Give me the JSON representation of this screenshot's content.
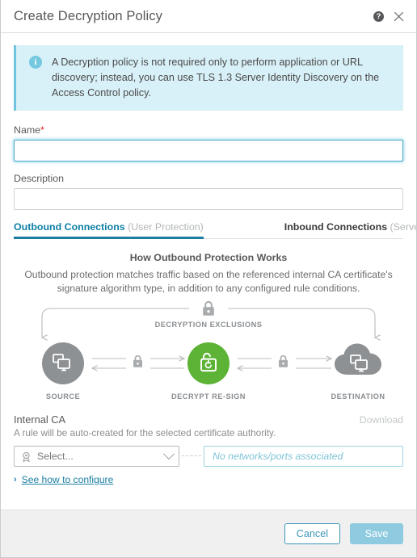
{
  "header": {
    "title": "Create Decryption Policy",
    "help_icon": "help-icon",
    "close_icon": "close-icon"
  },
  "banner": {
    "icon": "info-icon",
    "text": "A Decryption policy is not required only to perform application or URL discovery; instead, you can use TLS 1.3 Server Identity Discovery on the Access Control policy."
  },
  "form": {
    "name_label": "Name",
    "name_required_mark": "*",
    "name_value": "",
    "name_placeholder": "",
    "description_label": "Description",
    "description_value": "",
    "description_placeholder": ""
  },
  "tabs": [
    {
      "main": "Outbound Connections",
      "sub": " (User Protection)",
      "active": true
    },
    {
      "main": "Inbound Connections",
      "sub": " (Server Protection)",
      "active": false
    }
  ],
  "diagram": {
    "title": "How Outbound Protection Works",
    "description": "Outbound protection matches traffic based on the referenced internal CA certificate's signature algorithm type, in addition to any configured rule conditions.",
    "exclusions_label": "DECRYPTION EXCLUSIONS",
    "source_label": "SOURCE",
    "center_label": "DECRYPT RE-SIGN",
    "destination_label": "DESTINATION",
    "colors": {
      "gray_node": "#8e9194",
      "green_node": "#5cb335",
      "line": "#b9bcbe",
      "label": "#8a8d90"
    },
    "icons": {
      "source": "monitors-icon",
      "center": "unlocked-padlock-resign-icon",
      "destination": "cloud-monitors-icon",
      "exclusion_lock": "padlock-icon",
      "left_lock": "padlock-icon",
      "right_lock": "padlock-icon"
    }
  },
  "internal_ca": {
    "title": "Internal CA",
    "download_label": "Download",
    "subtitle": "A rule will be auto-created for the selected certificate authority.",
    "select_value": "Select...",
    "select_icon": "certificate-seal-icon",
    "networks_placeholder": "No networks/ports associated",
    "see_how_label": "See how to configure",
    "see_how_arrow": "›"
  },
  "footer": {
    "cancel_label": "Cancel",
    "save_label": "Save"
  },
  "colors": {
    "accent": "#1b7fa3",
    "banner_bg": "#d8f0f7",
    "banner_border": "#6fc5de",
    "required": "#e2231a",
    "save_disabled": "#8fcbe0"
  }
}
